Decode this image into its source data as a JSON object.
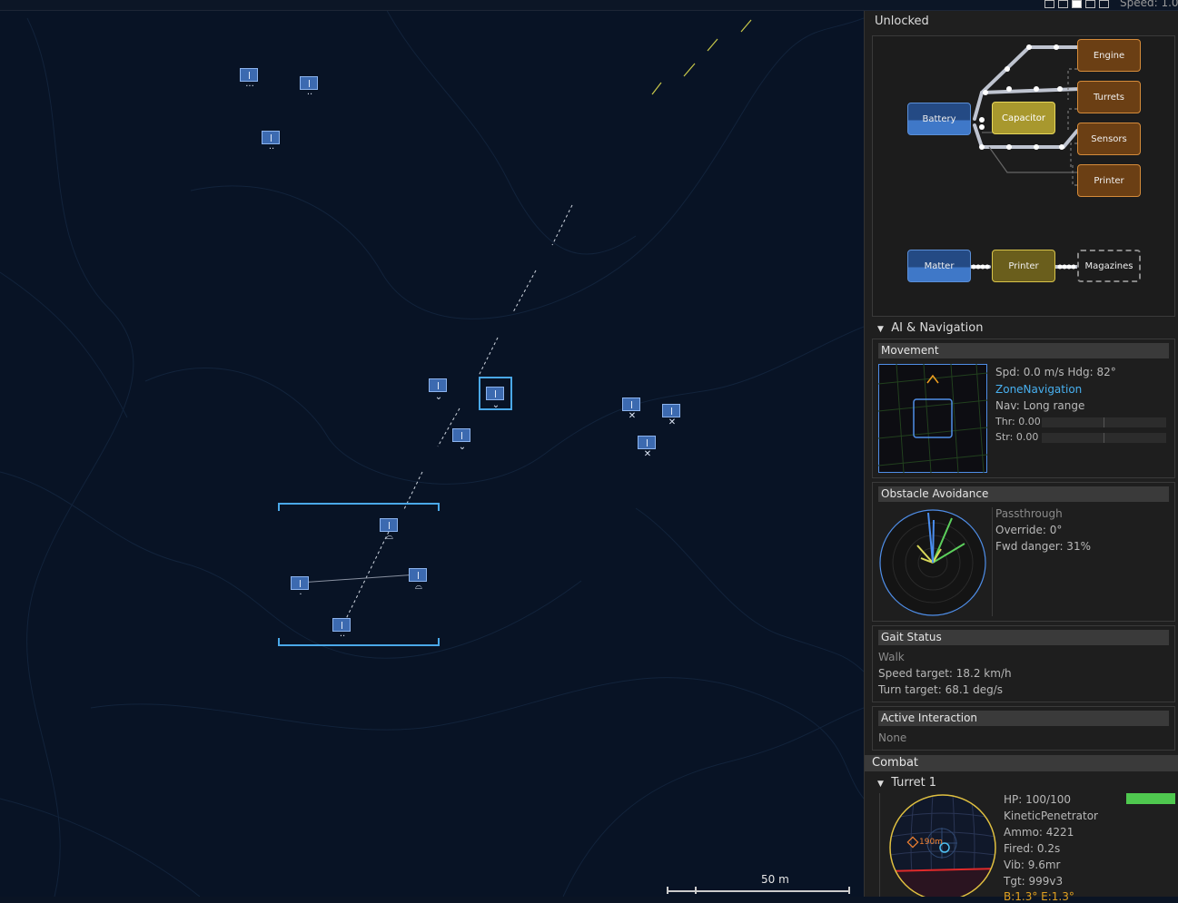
{
  "top_bar": {
    "speed_label": "Speed: 1.0"
  },
  "map": {
    "scale_label": "50 m"
  },
  "unlocked": {
    "title": "Unlocked",
    "nodes": {
      "engine": "Engine",
      "turrets": "Turrets",
      "sensors": "Sensors",
      "printer_top": "Printer",
      "battery": "Battery",
      "capacitor": "Capacitor",
      "matter": "Matter",
      "printer_bottom": "Printer",
      "magazines": "Magazines"
    }
  },
  "ai_nav": {
    "title": "AI & Navigation",
    "movement": {
      "title": "Movement",
      "spd_hdg": "Spd: 0.0 m/s  Hdg: 82°",
      "mode": "ZoneNavigation",
      "nav": "Nav: Long range",
      "thr": "Thr: 0.00",
      "str": "Str: 0.00"
    },
    "obstacle": {
      "title": "Obstacle Avoidance",
      "mode": "Passthrough",
      "override": "Override: 0°",
      "fwd_danger": "Fwd danger: 31%"
    },
    "gait": {
      "title": "Gait Status",
      "mode": "Walk",
      "speed_target": "Speed target: 18.2 km/h",
      "turn_target": "Turn target: 68.1 deg/s"
    },
    "interaction": {
      "title": "Active Interaction",
      "value": "None"
    }
  },
  "combat": {
    "title": "Combat",
    "turret": {
      "title": "Turret 1",
      "hp": "HP: 100/100",
      "hp_fraction": 1.0,
      "ammo_type": "KineticPenetrator",
      "ammo": "Ammo: 4221",
      "fired": "Fired: 0.2s",
      "vib": "Vib: 9.6mr",
      "tgt": "Tgt: 999v3",
      "extra": "B:1.3° E:1.3°",
      "range_label": "190m"
    }
  }
}
